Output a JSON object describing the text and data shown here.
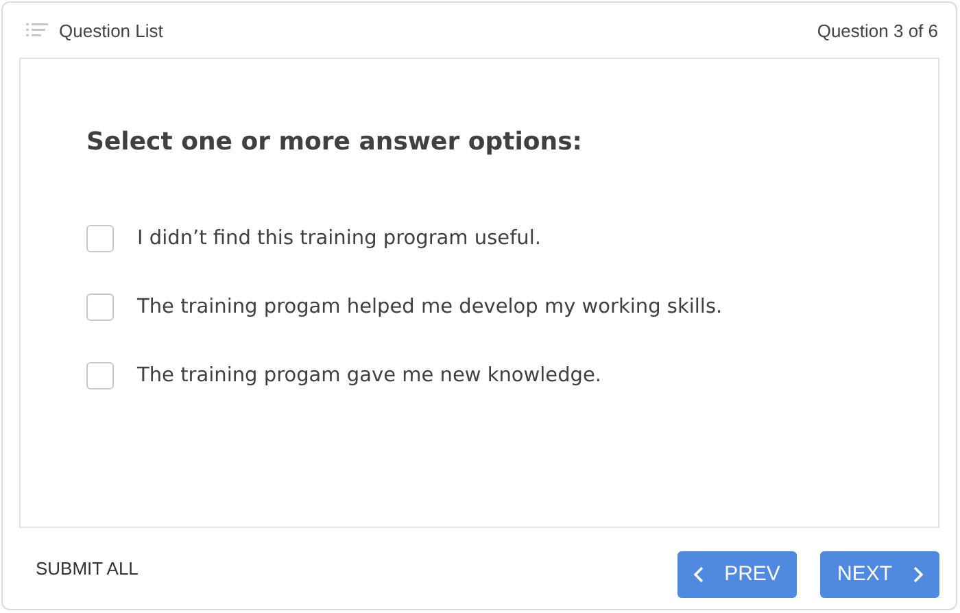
{
  "header": {
    "title": "Question List",
    "progress": "Question 3 of 6"
  },
  "question": "Select one or more answer options:",
  "options": [
    {
      "label": "I didn’t find this training program useful.",
      "checked": false
    },
    {
      "label": "The training progam helped me develop my working skills.",
      "checked": false
    },
    {
      "label": "The training progam gave me new knowledge.",
      "checked": false
    }
  ],
  "footer": {
    "submit": "SUBMIT ALL",
    "prev": "PREV",
    "next": "NEXT"
  }
}
